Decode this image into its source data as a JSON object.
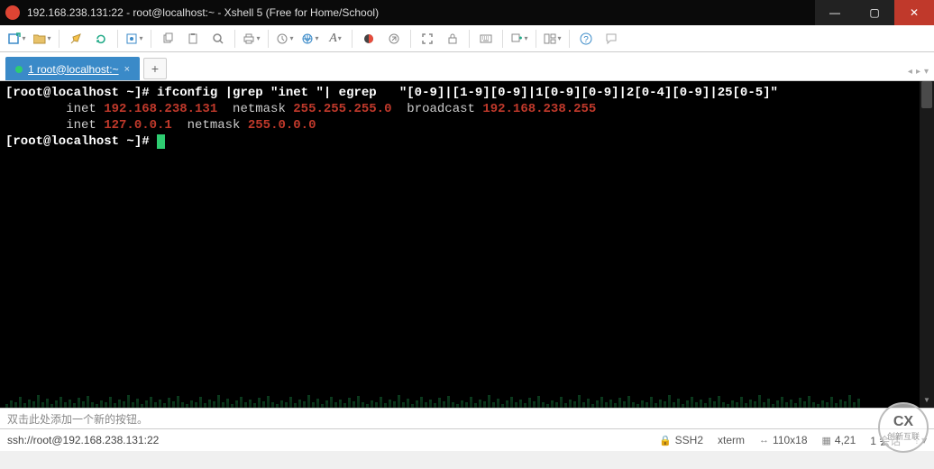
{
  "title": "192.168.238.131:22 - root@localhost:~ - Xshell 5 (Free for Home/School)",
  "tab": {
    "label": "1 root@localhost:~",
    "add": "+"
  },
  "terminal": {
    "line1_prompt": "[root@localhost ~]# ",
    "line1_cmd": "ifconfig |grep \"inet \"| egrep   \"[0-9]|[1-9][0-9]|1[0-9][0-9]|2[0-4][0-9]|25[0-5]\"",
    "line2_pre": "        inet ",
    "line2_ip": "192.168.238.131",
    "line2_mid": "  netmask ",
    "line2_mask": "255.255.255.0",
    "line2_bcast_lbl": "  broadcast ",
    "line2_bcast": "192.168.238.255",
    "line3_pre": "        inet ",
    "line3_ip": "127.0.0.1",
    "line3_mid": "  netmask ",
    "line3_mask": "255.0.0.0",
    "line4_prompt": "[root@localhost ~]# "
  },
  "button_add_hint": "双击此处添加一个新的按钮。",
  "status": {
    "conn": "ssh://root@192.168.238.131:22",
    "ssh": "SSH2",
    "term": "xterm",
    "size": "110x18",
    "pos": "4,21",
    "sess": "1 会话"
  },
  "watermark": {
    "big": "CX",
    "small": "创新互联"
  }
}
